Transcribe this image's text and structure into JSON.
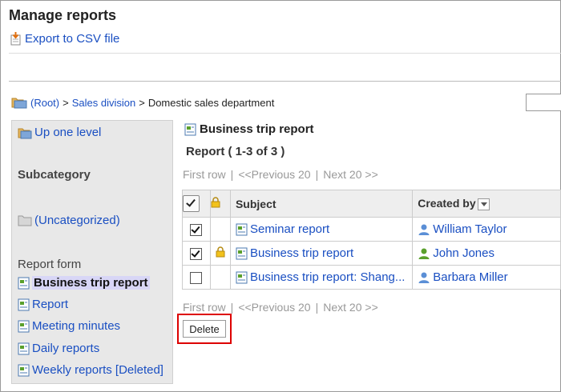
{
  "page": {
    "title": "Manage reports",
    "export_label": "Export to CSV file"
  },
  "breadcrumb": {
    "root": "(Root)",
    "sep1": ">",
    "sales": "Sales division",
    "sep2": ">",
    "current": "Domestic sales department"
  },
  "sidebar": {
    "up_one_level": "Up one level",
    "subcategory_heading": "Subcategory",
    "uncategorized": "(Uncategorized)",
    "report_form_heading": "Report form",
    "forms": [
      "Business trip report",
      "Report",
      "Meeting minutes",
      "Daily reports",
      "Weekly reports [Deleted]"
    ]
  },
  "main": {
    "title": "Business trip report",
    "count": "Report ( 1-3 of 3 )",
    "pager": {
      "first": "First row",
      "bar": "|",
      "prev": "<<Previous 20",
      "next": "Next 20 >>"
    },
    "columns": {
      "subject": "Subject",
      "created_by": "Created by"
    },
    "rows": [
      {
        "checked": true,
        "locked": false,
        "subject": "Seminar report",
        "created_by": "William Taylor",
        "user_color": "#5b8fd6"
      },
      {
        "checked": true,
        "locked": true,
        "subject": "Business trip report",
        "created_by": "John Jones",
        "user_color": "#5aa02c"
      },
      {
        "checked": false,
        "locked": false,
        "subject": "Business trip report: Shang...",
        "created_by": "Barbara Miller",
        "user_color": "#5b8fd6"
      }
    ],
    "delete_label": "Delete"
  },
  "colors": {
    "link": "#1a4fc2",
    "highlight": "#d8d6f6",
    "callout": "#dd0000"
  }
}
